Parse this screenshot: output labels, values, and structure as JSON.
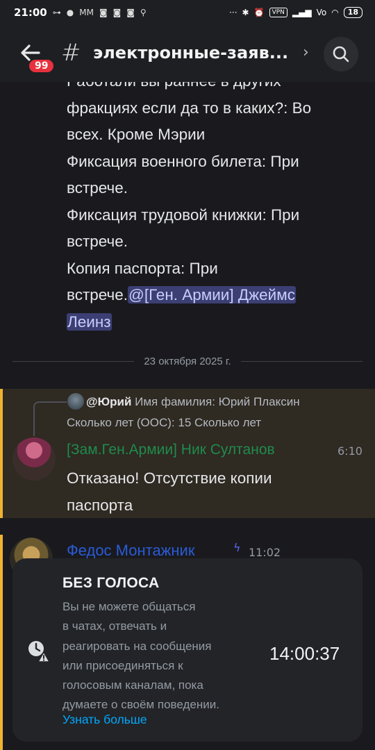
{
  "status_bar": {
    "time": "21:00",
    "dots": "···",
    "vpn": "VPN",
    "battery": "18"
  },
  "header": {
    "badge": "99",
    "hash": "#",
    "channel_name": "электронные-заяв...",
    "chevron": "›"
  },
  "chat": {
    "prev_message_lines": [
      "Работали вы раннее в других",
      "фракциях если да то в каких?: Во",
      "всех. Кроме Мэрии",
      "Фиксация военного билета: При",
      "встрече.",
      "Фиксация трудовой книжки: При",
      "встрече.",
      "Копия паспорта: При"
    ],
    "prev_message_tail": "встрече.",
    "mention_part1": "@[Ген. Армии] Джеймс",
    "mention_part2": "Леинз",
    "date_divider": "23 октября 2025 г.",
    "reply": {
      "author": "@Юрий",
      "text1": "Имя фамилия: Юрий Плаксин",
      "text2": "Сколько лет (ООС): 15 Сколько лет"
    },
    "message1": {
      "author": "[Зам.Ген.Армии] Ник Султанов",
      "time": "6:10",
      "line1": "Отказано! Отсутствие копии",
      "line2": "паспорта"
    },
    "message2": {
      "author": "Федос Монтажник",
      "time": "11:02"
    }
  },
  "timeout_card": {
    "title": "БЕЗ ГОЛОСА",
    "desc_lines": [
      "Вы не можете общаться",
      "в чатах, отвечать и",
      "реагировать на сообщения",
      "или присоединяться к",
      "голосовым каналам, пока",
      "думаете о своём поведении."
    ],
    "link": "Узнать больше",
    "timer": "14:00:37"
  },
  "colors": {
    "accent_mention_bg": "#3b3f74",
    "highlight_border": "#f0b232",
    "author1_color": "#1f8b4c",
    "author2_color": "#2a5bd7",
    "link_color": "#00a8fc"
  }
}
